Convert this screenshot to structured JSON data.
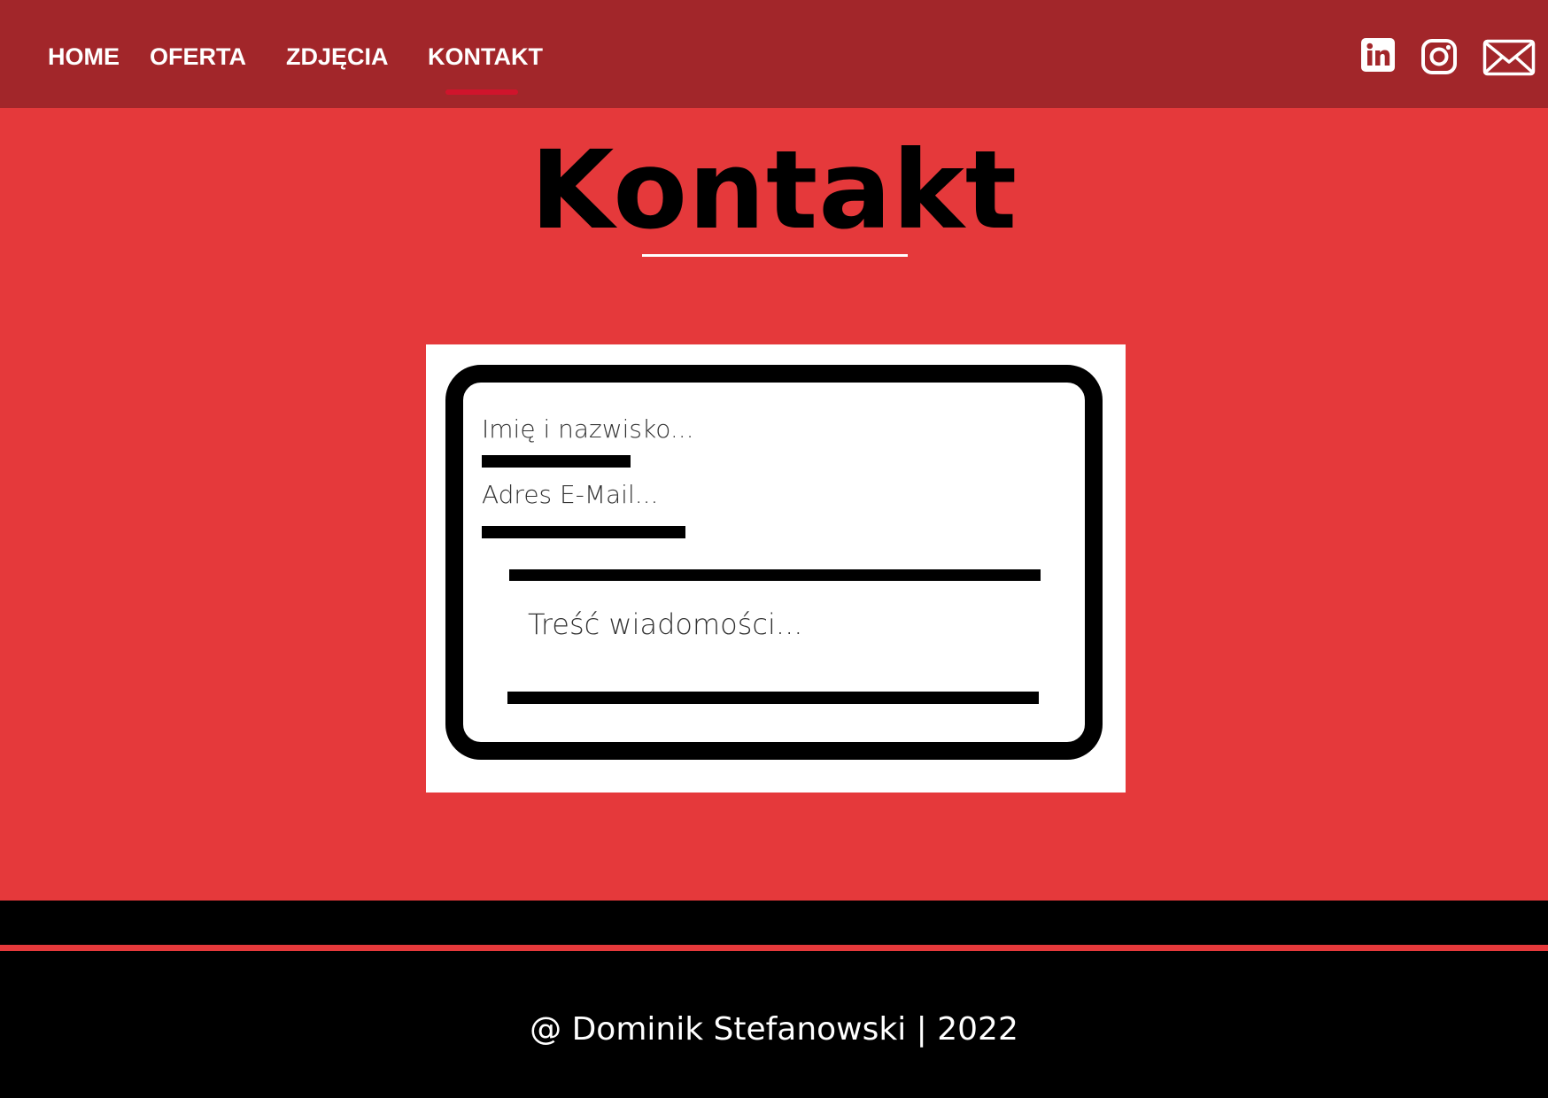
{
  "nav": {
    "items": [
      {
        "label": "HOME"
      },
      {
        "label": "OFERTA"
      },
      {
        "label": "ZDJĘCIA"
      },
      {
        "label": "KONTAKT",
        "active": true
      }
    ]
  },
  "social": {
    "icons": [
      "linkedin-icon",
      "instagram-icon",
      "mail-icon"
    ]
  },
  "page": {
    "title": "Kontakt"
  },
  "form": {
    "name_placeholder": "Imię i nazwisko...",
    "email_placeholder": "Adres E-Mail...",
    "message_placeholder": "Treść wiadomości..."
  },
  "footer": {
    "text": "@ Dominik Stefanowski | 2022"
  },
  "colors": {
    "header_bg": "#a2262a",
    "page_bg": "#e5393b",
    "active_underline": "#d0142c",
    "footer_bg": "#000000"
  }
}
